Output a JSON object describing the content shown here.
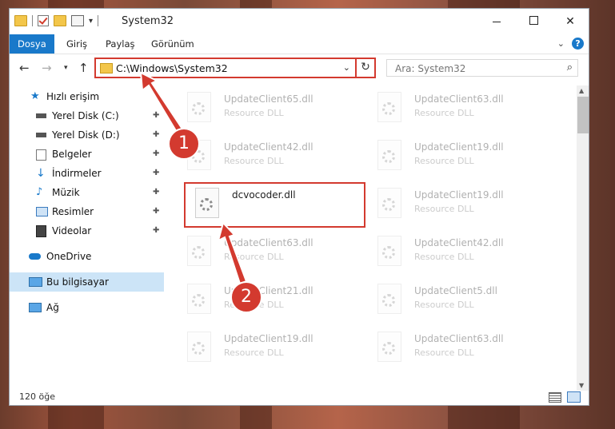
{
  "window": {
    "title": "System32",
    "buttons": {
      "minimize": "—",
      "maximize": "□",
      "close": "✕"
    }
  },
  "ribbon": {
    "tabs": [
      "Dosya",
      "Giriş",
      "Paylaş",
      "Görünüm"
    ],
    "collapse_icon": "chevron-down-icon",
    "help_label": "?"
  },
  "nav": {
    "back": "←",
    "forward": "→",
    "recent": "▾",
    "up": "↑",
    "address": "C:\\Windows\\System32",
    "refresh": "↻",
    "search_placeholder": "Ara: System32",
    "search_icon": "⌕"
  },
  "sidebar": {
    "items": [
      {
        "label": "Hızlı erişim",
        "icon": "star-icon",
        "pinned": false
      },
      {
        "label": "Yerel Disk (C:)",
        "icon": "drive-icon",
        "pinned": true
      },
      {
        "label": "Yerel Disk (D:)",
        "icon": "drive-icon",
        "pinned": true
      },
      {
        "label": "Belgeler",
        "icon": "documents-icon",
        "pinned": true
      },
      {
        "label": "İndirmeler",
        "icon": "download-icon",
        "pinned": true
      },
      {
        "label": "Müzik",
        "icon": "music-icon",
        "pinned": true
      },
      {
        "label": "Resimler",
        "icon": "pictures-icon",
        "pinned": true
      },
      {
        "label": "Videolar",
        "icon": "video-icon",
        "pinned": true
      },
      {
        "label": "OneDrive",
        "icon": "cloud-icon",
        "pinned": false
      },
      {
        "label": "Bu bilgisayar",
        "icon": "computer-icon",
        "pinned": false,
        "selected": true
      },
      {
        "label": "Ağ",
        "icon": "network-icon",
        "pinned": false
      }
    ],
    "pin_glyph": "📌"
  },
  "files": [
    {
      "name": "UpdateClient65.dll",
      "type": "Resource DLL",
      "faded": true
    },
    {
      "name": "UpdateClient63.dll",
      "type": "Resource DLL",
      "faded": true
    },
    {
      "name": "UpdateClient42.dll",
      "type": "Resource DLL",
      "faded": true
    },
    {
      "name": "UpdateClient19.dll",
      "type": "Resource DLL",
      "faded": true
    },
    {
      "name": "dcvocoder.dll",
      "type": "",
      "faded": false
    },
    {
      "name": "UpdateClient19.dll",
      "type": "Resource DLL",
      "faded": true
    },
    {
      "name": "UpdateClient63.dll",
      "type": "Resource DLL",
      "faded": true
    },
    {
      "name": "UpdateClient42.dll",
      "type": "Resource DLL",
      "faded": true
    },
    {
      "name": "UpdateClient21.dll",
      "type": "Resource DLL",
      "faded": true
    },
    {
      "name": "UpdateClient5.dll",
      "type": "Resource DLL",
      "faded": true
    },
    {
      "name": "UpdateClient19.dll",
      "type": "Resource DLL",
      "faded": true
    },
    {
      "name": "UpdateClient63.dll",
      "type": "Resource DLL",
      "faded": true
    }
  ],
  "status": {
    "count": "120 öğe"
  },
  "annotations": {
    "step1": "1",
    "step2": "2",
    "color": "#d33a2f"
  },
  "colors": {
    "accent": "#1979ca",
    "highlight": "#d33a2f",
    "selection": "#cce4f7"
  }
}
